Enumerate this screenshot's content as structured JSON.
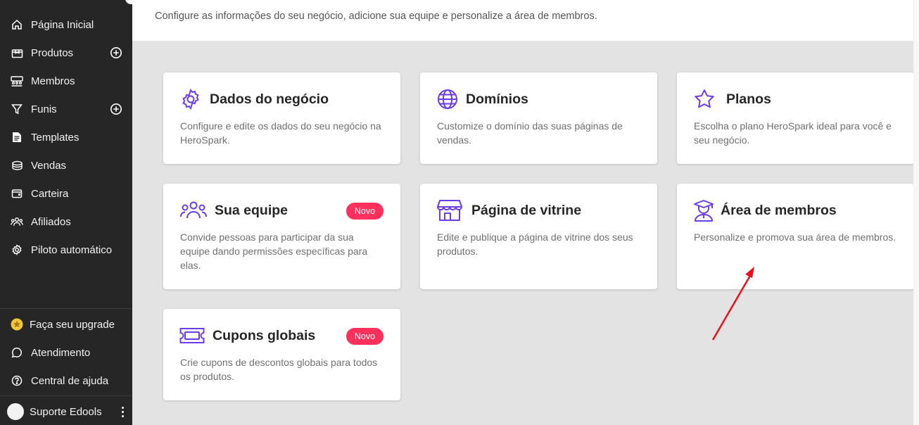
{
  "sidebar": {
    "items": [
      {
        "label": "Página Inicial",
        "icon": "home-icon"
      },
      {
        "label": "Produtos",
        "icon": "box-icon"
      },
      {
        "label": "Membros",
        "icon": "members-icon"
      },
      {
        "label": "Funis",
        "icon": "funnel-icon"
      },
      {
        "label": "Templates",
        "icon": "document-icon"
      },
      {
        "label": "Vendas",
        "icon": "money-icon"
      },
      {
        "label": "Carteira",
        "icon": "wallet-icon"
      },
      {
        "label": "Afiliados",
        "icon": "affiliates-icon"
      },
      {
        "label": "Piloto automático",
        "icon": "gear-icon"
      }
    ],
    "bottom": [
      {
        "label": "Faça seu upgrade",
        "icon": "star-icon"
      },
      {
        "label": "Atendimento",
        "icon": "chat-icon"
      },
      {
        "label": "Central de ajuda",
        "icon": "help-icon"
      }
    ],
    "user": {
      "name": "Suporte Edools"
    }
  },
  "header": {
    "subtitle": "Configure as informações do seu negócio, adicione sua equipe e personalize a área de membros."
  },
  "cards": [
    {
      "title": "Dados do negócio",
      "description": "Configure e edite os dados do seu negócio na HeroSpark.",
      "icon": "settings-gear-icon"
    },
    {
      "title": "Domínios",
      "description": "Customize o domínio das suas páginas de vendas.",
      "icon": "globe-icon"
    },
    {
      "title": "Planos",
      "description": "Escolha o plano HeroSpark ideal para você e seu negócio.",
      "icon": "star-outline-icon"
    },
    {
      "title": "Sua equipe",
      "description": "Convide pessoas para participar da sua equipe dando permissões específicas para elas.",
      "icon": "team-icon",
      "badge": "Novo"
    },
    {
      "title": "Página de vitrine",
      "description": "Edite e publique a página de vitrine dos seus produtos.",
      "icon": "storefront-icon"
    },
    {
      "title": "Área de membros",
      "description": "Personalize e promova sua área de membros.",
      "icon": "graduate-icon"
    },
    {
      "title": "Cupons globais",
      "description": "Crie cupons de descontos globais para todos os produtos.",
      "icon": "coupon-icon",
      "badge": "Novo"
    }
  ],
  "colors": {
    "accent": "#6c3ce9",
    "badge": "#ff305c",
    "sidebar": "#262626",
    "annotation": "#e8101a"
  }
}
